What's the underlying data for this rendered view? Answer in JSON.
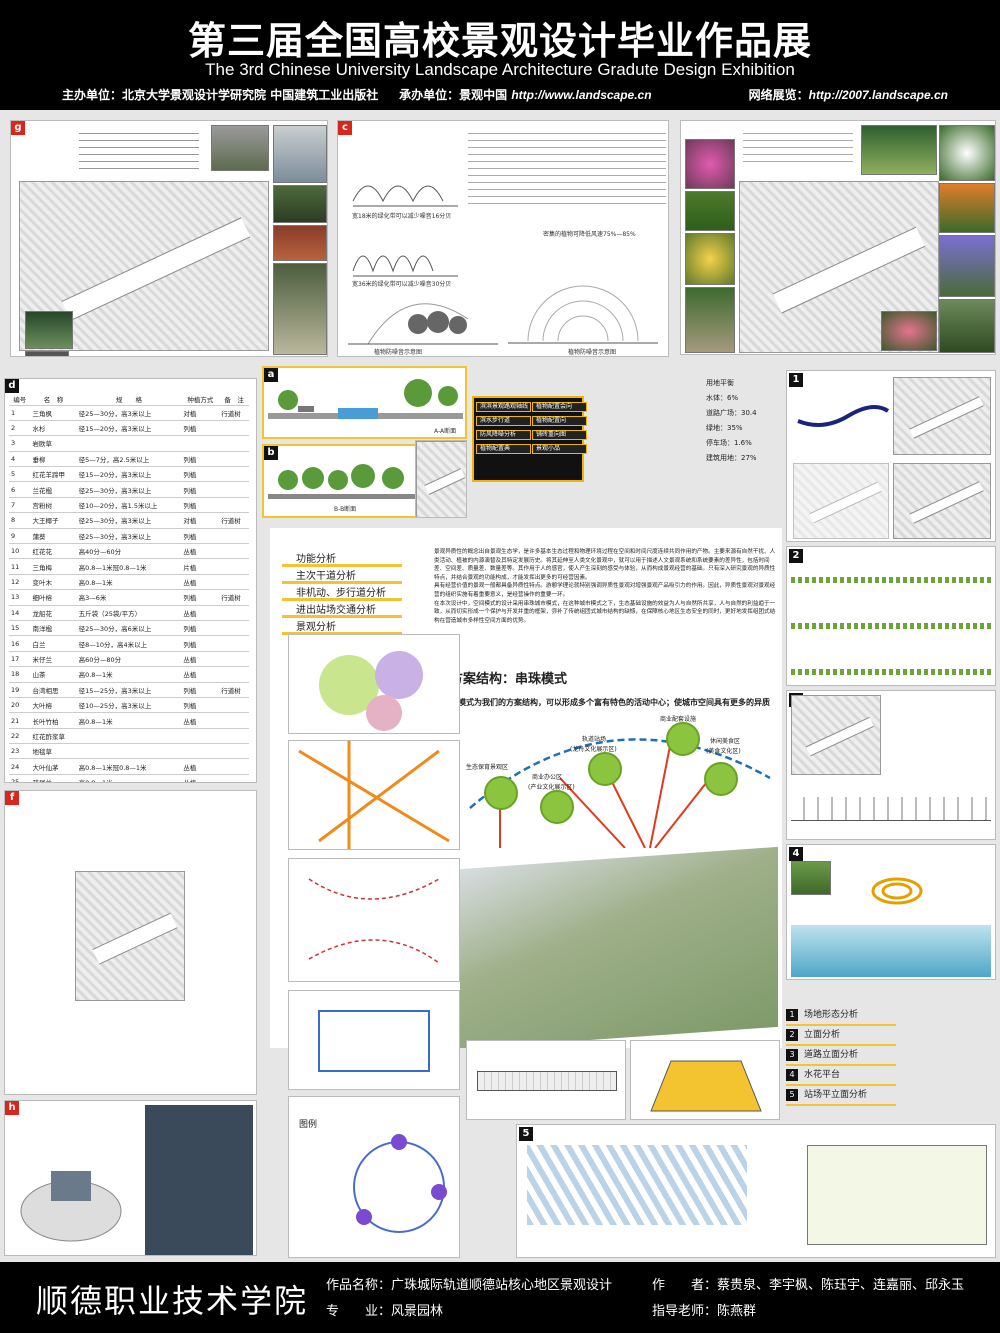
{
  "header": {
    "title_cn": "第三届全国高校景观设计毕业作品展",
    "title_en": "The 3rd Chinese University Landscape Architecture Gradute Design Exhibition",
    "organizer_label": "主办单位：",
    "organizers": "北京大学景观设计学研究院  中国建筑工业出版社",
    "co_label": "承办单位：",
    "co_organizer": "景观中国",
    "co_url": "http://www.landscape.cn",
    "web_label": "网络展览：",
    "web_url": "http://2007.landscape.cn"
  },
  "panels": {
    "g": {
      "tag": "g"
    },
    "c": {
      "tag": "c",
      "cap1": "宽18米的绿化带可以减少噪音16分贝",
      "cap2": "宽36米的绿化带可以减少噪音30分贝",
      "cap3": "密集的植物可降低风速75%—85%",
      "cap4": "植物防噪音示意图",
      "cap5": "植物防噪音示意图"
    },
    "e": {
      "tag": "e"
    },
    "d": {
      "tag": "d"
    },
    "a": {
      "tag": "a",
      "sec": "A-A断面"
    },
    "b": {
      "tag": "b",
      "sec": "B-B断面"
    },
    "f": {
      "tag": "f"
    },
    "h": {
      "tag": "h"
    }
  },
  "plant_table": {
    "headers": [
      "编号",
      "名　称",
      "规　　格",
      "种植方式",
      "备　注"
    ],
    "rows": [
      [
        "1",
        "三角枫",
        "径25—30分，高3米以上",
        "对植",
        "行道树"
      ],
      [
        "2",
        "水杉",
        "径15—20分，高3米以上",
        "列植",
        ""
      ],
      [
        "3",
        "岩欧草",
        "",
        "",
        ""
      ],
      [
        "4",
        "垂柳",
        "径5—7分，高2.5米以上",
        "列植",
        ""
      ],
      [
        "5",
        "红花羊蹄甲",
        "径15—20分，高3米以上",
        "列植",
        ""
      ],
      [
        "6",
        "兰花楹",
        "径25—30分，高3米以上",
        "列植",
        ""
      ],
      [
        "7",
        "宫粉树",
        "径10—20分，高1.5米以上",
        "列植",
        ""
      ],
      [
        "8",
        "大王椰子",
        "径25—30分，高3米以上",
        "对植",
        "行道树"
      ],
      [
        "9",
        "蒲葵",
        "径25—30分，高3米以上",
        "列植",
        ""
      ],
      [
        "10",
        "红花花",
        "高40分—60分",
        "丛植",
        ""
      ],
      [
        "11",
        "三角梅",
        "高0.8—1米冠0.8—1米",
        "片植",
        ""
      ],
      [
        "12",
        "变叶木",
        "高0.8—1米",
        "丛植",
        ""
      ],
      [
        "13",
        "细叶榕",
        "高3—6米",
        "列植",
        "行道树"
      ],
      [
        "14",
        "龙船花",
        "五斤袋（25袋/平方）",
        "丛植",
        ""
      ],
      [
        "15",
        "南洋楹",
        "径25—30分，高6米以上",
        "列植",
        ""
      ],
      [
        "16",
        "白兰",
        "径8—10分，高4米以上",
        "列植",
        ""
      ],
      [
        "17",
        "米仔兰",
        "高60分—80分",
        "丛植",
        ""
      ],
      [
        "18",
        "山茶",
        "高0.8—1米",
        "丛植",
        ""
      ],
      [
        "19",
        "台湾相思",
        "径15—25分，高3米以上",
        "列植",
        "行道树"
      ],
      [
        "20",
        "大叶榕",
        "径10—25分，高3米以上",
        "列植",
        ""
      ],
      [
        "21",
        "长叶竹柏",
        "高0.8—1米",
        "丛植",
        ""
      ],
      [
        "22",
        "红花酢浆草",
        "",
        "",
        ""
      ],
      [
        "23",
        "地毯草",
        "",
        "",
        ""
      ],
      [
        "24",
        "大叶仙茅",
        "高0.8—1米冠0.8—1米",
        "丛植",
        ""
      ],
      [
        "25",
        "疏尾兰",
        "高0.8—1米",
        "丛植",
        ""
      ]
    ]
  },
  "legend": [
    "滨滨景观路观轴线",
    "植物配置会向",
    "滨水步行道",
    "植物配置向",
    "防风降噪分析",
    "铺砖重向图",
    "植物配置典",
    "景观小品"
  ],
  "stats": {
    "title": "用地平衡",
    "items": [
      "水体：6%",
      "道路广场：30.4",
      "绿地：35%",
      "停车场：1.6%",
      "建筑用地：27%"
    ]
  },
  "analysis": [
    "功能分析",
    "主次干道分析",
    "非机动、步行道分析",
    "进出站场交通分析",
    "景观分析"
  ],
  "concept": {
    "para1": "景观异质性的概念出自景观生态学，是许多基本生态过程和物理环境过程在空间和时间尺度连续共同作用的产物。主要来源有自然干扰、人类活动、植被的内源演替及其特定发展历史。将其延伸至人类文化景观中，就可以用于描述人文景观系统和系统要素的差异性，包括时间差、空间差、质量差、数量差等。其作用于人的感官，使人产生深刻的感受与体验，从而构成景观经营的基础。只有深入研究景观的异质性特点，并结合景观的功能构成，才能发挥出更多的可经营因素。",
    "para2": "具有经营价值的景观一般都具备异质性特点。游憩学理论就特别强调异质性景观对增强景观产品吸引力的作用。因此，异质性景观对景观经营的组织实施有着重要意义，是经营操作的重要一环。",
    "para3": "在本次设计中，空间模式的设计采用串珠城市模式，在这种城市模式之下，生态基础设施的效益为人与自然所共享，人与自然的利益趋于一致，从而切实形成一个保护与开发并重的框架，弥补了传统组团式城市结构的缺憾，在保障核心地区生态安全的同时，更好地发挥组团式结构在营造城市多样性空间方面的优势。",
    "scheme_title": "方案结构：串珠模式",
    "scheme_desc": "以串珠模式为我们的方案结构，可以形成多个富有特色的活动中心；使城市空间具有更多的异质性。",
    "nodes": [
      "生态保育景观区",
      "商业办公区",
      "(产业文化展示区)",
      "轨道站场",
      "(龙舟文化展示区)",
      "商业配套设施",
      "休闲美食区",
      "(美食文化区)"
    ]
  },
  "right_list": [
    "场地形态分析",
    "立面分析",
    "道路立面分析",
    "水花平台",
    "站场平立面分析"
  ],
  "bottom_legend": {
    "title": "图例"
  },
  "footer": {
    "school": "顺德职业技术学院",
    "work_label": "作品名称：",
    "work": "广珠城际轨道顺德站核心地区景观设计",
    "major_label": "专　　业：",
    "major": "风景园林",
    "author_label": "作　　者：",
    "authors": "蔡贵泉、李宇枫、陈珏宇、连嘉丽、邱永玉",
    "advisor_label": "指导老师：",
    "advisor": "陈燕群"
  },
  "colors": {
    "accent_yellow": "#f4c430",
    "tag_red": "#d9261c",
    "node_green": "#8bc53f",
    "arc_blue": "#1f6fb5",
    "line_red": "#e03a1e"
  }
}
